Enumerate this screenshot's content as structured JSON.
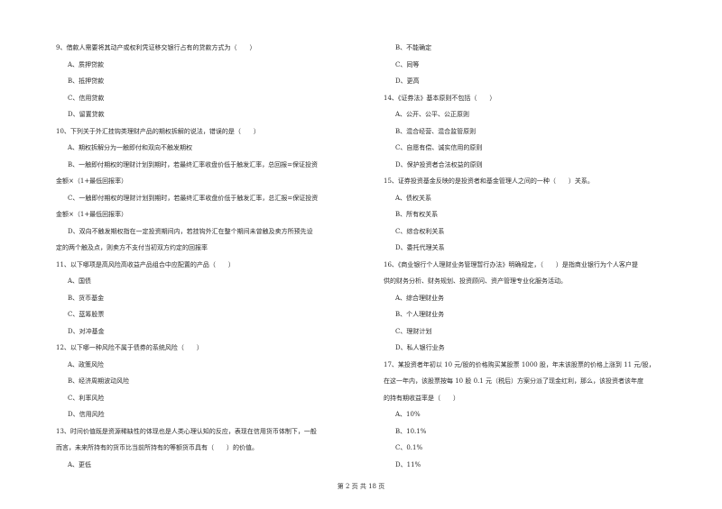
{
  "left_column": [
    {
      "type": "q",
      "text": "9、借款人需要将其动产或权利凭证移交银行占有的贷款方式为（　　）"
    },
    {
      "type": "o",
      "text": "A、质押贷款"
    },
    {
      "type": "o",
      "text": "B、抵押贷款"
    },
    {
      "type": "o",
      "text": "C、信用贷款"
    },
    {
      "type": "o",
      "text": "D、留置贷款"
    },
    {
      "type": "q",
      "text": "10、下列关于外汇挂钩类理财产品的期权拆解的说法，错误的是（　　）"
    },
    {
      "type": "o",
      "text": "A、期权拆解分为一触即付和双向不触发期权"
    },
    {
      "type": "o",
      "text": "B、一触即付期权的理财计划到期时，若最终汇率收盘价低于触发汇率，总回报=保证投资"
    },
    {
      "type": "c",
      "text": "金额×（1+最低回报率）"
    },
    {
      "type": "o",
      "text": "C、一触即付期权的理财计划到期时，若最终汇率收盘价低于触发汇率，总汇报=保证投资"
    },
    {
      "type": "c",
      "text": "金额×（1+最低回报率）"
    },
    {
      "type": "o",
      "text": "D、双向不触发期权指在一定投资期间内，若挂钩外汇在整个期间未曾触及卖方所预先设"
    },
    {
      "type": "c",
      "text": "定的两个触及点，则卖方不支付当初双方约定的回报率"
    },
    {
      "type": "q",
      "text": "11、以下哪项是高风险高收益产品组合中应配置的产品（　　）"
    },
    {
      "type": "o",
      "text": "A、国债"
    },
    {
      "type": "o",
      "text": "B、货币基金"
    },
    {
      "type": "o",
      "text": "C、蓝筹股票"
    },
    {
      "type": "o",
      "text": "D、对冲基金"
    },
    {
      "type": "q",
      "text": "12、以下哪一种风险不属于债券的系统风险（　　）"
    },
    {
      "type": "o",
      "text": "A、政策风险"
    },
    {
      "type": "o",
      "text": "B、经济周期波动风险"
    },
    {
      "type": "o",
      "text": "C、利率风险"
    },
    {
      "type": "o",
      "text": "D、信用风险"
    },
    {
      "type": "q",
      "text": "13、时间价值既是资源稀缺性的体现也是人类心理认知的反应，表现在信用货币体制下，一般"
    },
    {
      "type": "c",
      "text": "而言，未来所持有的货币比当前所持有的等额货币具有（　　）的价值。"
    },
    {
      "type": "o",
      "text": "A、更低"
    }
  ],
  "right_column": [
    {
      "type": "o",
      "text": "B、不能确定"
    },
    {
      "type": "o",
      "text": "C、同等"
    },
    {
      "type": "o",
      "text": "D、更高"
    },
    {
      "type": "q",
      "text": "14、《证券法》基本原则不包括（　　）"
    },
    {
      "type": "o",
      "text": "A、公开、公平、公正原则"
    },
    {
      "type": "o",
      "text": "B、混合经营、混合监管原则"
    },
    {
      "type": "o",
      "text": "C、自愿有偿、诚实信用的原则"
    },
    {
      "type": "o",
      "text": "D、保护投资者合法权益的原则"
    },
    {
      "type": "q",
      "text": "15、证券投资基金反映的是投资者和基金管理人之间的一种（　　）关系。"
    },
    {
      "type": "o",
      "text": "A、债权关系"
    },
    {
      "type": "o",
      "text": "B、所有权关系"
    },
    {
      "type": "o",
      "text": "C、综合权利关系"
    },
    {
      "type": "o",
      "text": "D、委托代理关系"
    },
    {
      "type": "q",
      "text": "16、《商业银行个人理财业务管理暂行办法》明确规定，（　　）是指商业银行为个人客户提"
    },
    {
      "type": "c",
      "text": "供的财务分析、财务规划、投资顾问、资产管理专业化服务活动。"
    },
    {
      "type": "o",
      "text": "A、综合理财业务"
    },
    {
      "type": "o",
      "text": "B、个人理财业务"
    },
    {
      "type": "o",
      "text": "C、理财计划"
    },
    {
      "type": "o",
      "text": "D、私人银行业务"
    },
    {
      "type": "q",
      "text": "17、某投资者年初以 10 元/股的价格购买某股票 1000 股，年末该股票的价格上涨到 11 元/股，"
    },
    {
      "type": "c",
      "text": "在这一年内，该股票按每 10 股 0.1 元（税后）方案分派了现金红利，那么，该投资者该年度"
    },
    {
      "type": "c",
      "text": "的持有期收益率是（　　）"
    },
    {
      "type": "o",
      "text": "A、10%"
    },
    {
      "type": "o",
      "text": "B、10.1%"
    },
    {
      "type": "o",
      "text": "C、0.1%"
    },
    {
      "type": "o",
      "text": "D、11%"
    }
  ],
  "footer": {
    "page_label": "第 2 页 共 18 页"
  }
}
